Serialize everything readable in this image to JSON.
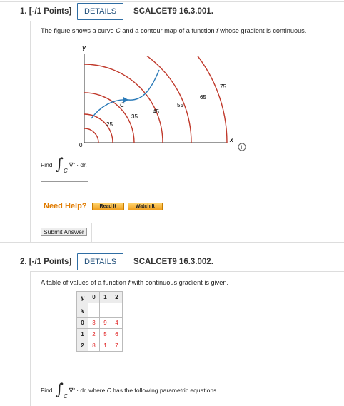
{
  "q1": {
    "number": "1. [-/1 Points]",
    "details_label": "DETAILS",
    "code": "SCALCET9 16.3.001.",
    "statement_parts": [
      "The figure shows a curve ",
      "C",
      " and a contour map of a function ",
      "f",
      " whose gradient is continuous."
    ],
    "figure": {
      "y_label": "y",
      "x_label": "x",
      "origin_label": "0",
      "curve_label": "C",
      "contour_labels": [
        "25",
        "35",
        "45",
        "55",
        "65",
        "75"
      ]
    },
    "find_label": "Find",
    "integral_sub": "C",
    "integrand": "∇f · dr.",
    "help_label": "Need Help?",
    "read_it": "Read It",
    "watch_it": "Watch It",
    "submit": "Submit Answer"
  },
  "q2": {
    "number": "2. [-/1 Points]",
    "details_label": "DETAILS",
    "code": "SCALCET9 16.3.002.",
    "statement_parts": [
      "A table of values of a function ",
      "f",
      " with continuous gradient is given."
    ],
    "table": {
      "corner_y": "y",
      "corner_x": "x",
      "col_headers": [
        "0",
        "1",
        "2"
      ],
      "row_headers": [
        "0",
        "1",
        "2"
      ],
      "rows": [
        [
          "3",
          "9",
          "4"
        ],
        [
          "2",
          "5",
          "6"
        ],
        [
          "8",
          "1",
          "7"
        ]
      ]
    },
    "find_label": "Find",
    "integral_sub": "C",
    "integrand_parts": [
      "∇f · dr, where ",
      "C",
      " has the following parametric equations."
    ]
  },
  "colors": {
    "accent": "#2e6da4",
    "contour": "#c0392b",
    "curve": "#2a7ab8",
    "help": "#e07b00"
  }
}
